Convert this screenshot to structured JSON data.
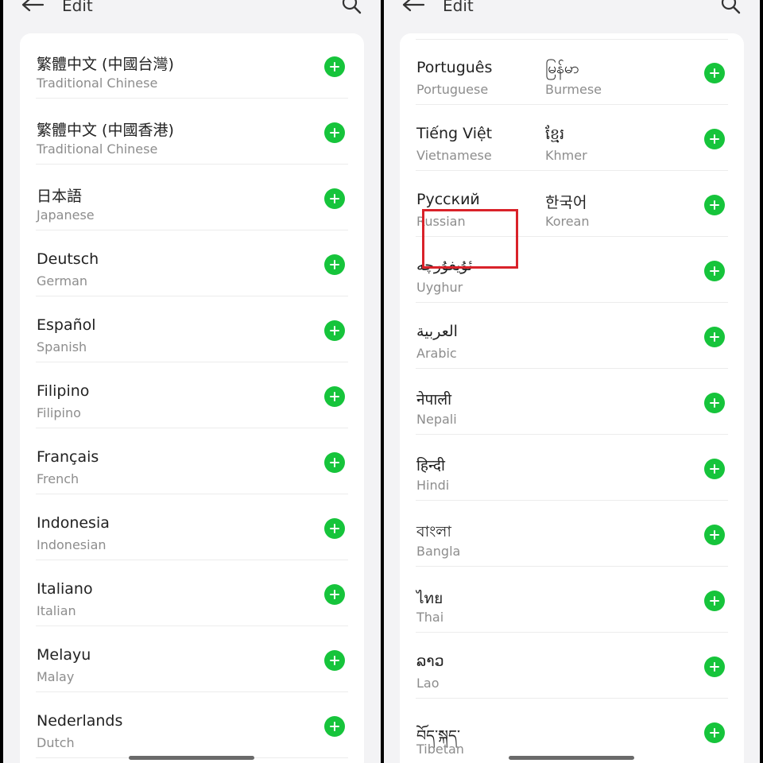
{
  "left": {
    "title": "Edit",
    "languages": [
      {
        "native": "繁體中文 (中國台灣)",
        "english": "Traditional Chinese"
      },
      {
        "native": "繁體中文 (中國香港)",
        "english": "Traditional Chinese"
      },
      {
        "native": "日本語",
        "english": "Japanese"
      },
      {
        "native": "Deutsch",
        "english": "German"
      },
      {
        "native": "Español",
        "english": "Spanish"
      },
      {
        "native": "Filipino",
        "english": "Filipino"
      },
      {
        "native": "Français",
        "english": "French"
      },
      {
        "native": "Indonesia",
        "english": "Indonesian"
      },
      {
        "native": "Italiano",
        "english": "Italian"
      },
      {
        "native": "Melayu",
        "english": "Malay"
      },
      {
        "native": "Nederlands",
        "english": "Dutch"
      }
    ]
  },
  "right": {
    "title": "Edit",
    "rows": [
      {
        "a_native": "Português",
        "a_english": "Portuguese",
        "b_native": "မြန်မာ",
        "b_english": "Burmese"
      },
      {
        "a_native": "Tiếng Việt",
        "a_english": "Vietnamese",
        "b_native": "ខ្មែរ",
        "b_english": "Khmer"
      },
      {
        "a_native": "Русский",
        "a_english": "Russian",
        "b_native": "한국어",
        "b_english": "Korean"
      },
      {
        "a_native": "ئۇيغۇرچە",
        "a_english": "Uyghur"
      },
      {
        "a_native": "العربية",
        "a_english": "Arabic"
      },
      {
        "a_native": "नेपाली",
        "a_english": "Nepali"
      },
      {
        "a_native": "हिन्दी",
        "a_english": "Hindi"
      },
      {
        "a_native": "বাংলা",
        "a_english": "Bangla"
      },
      {
        "a_native": "ไทย",
        "a_english": "Thai"
      },
      {
        "a_native": "ລາວ",
        "a_english": "Lao"
      },
      {
        "a_native": "བོད་སྐད་",
        "a_english": "Tibetan"
      }
    ]
  },
  "colors": {
    "add_button": "#16c43b",
    "highlight": "#d9222a"
  },
  "icons": {
    "back": "back-arrow-icon",
    "search": "search-icon",
    "add": "add-circle-icon"
  }
}
